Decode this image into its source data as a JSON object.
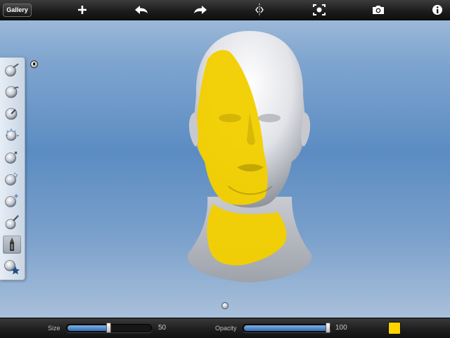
{
  "toolbar": {
    "gallery_label": "Gallery",
    "icons": [
      "plus-icon",
      "undo-arrow-icon",
      "redo-arrow-icon",
      "symmetry-icon",
      "reset-view-icon",
      "camera-icon",
      "info-icon"
    ]
  },
  "tools": [
    "brush-tool",
    "smooth-brush-tool",
    "hook-brush-tool",
    "spiky-brush-tool",
    "pinch-brush-tool",
    "flatten-brush-tool",
    "inflate-brush-tool",
    "crease-brush-tool",
    "paint-pen-tool",
    "material-star-tool"
  ],
  "active_tool": "paint-pen-tool",
  "bottombar": {
    "size_label": "Size",
    "size_value": "50",
    "size_fraction": 0.5,
    "opacity_label": "Opacity",
    "opacity_value": "100",
    "opacity_fraction": 1.0,
    "paint_color": "#ffd400"
  },
  "colors": {
    "paint": "#f3cf00",
    "model": "#e8e8ec",
    "accent": "#2f6db5"
  }
}
